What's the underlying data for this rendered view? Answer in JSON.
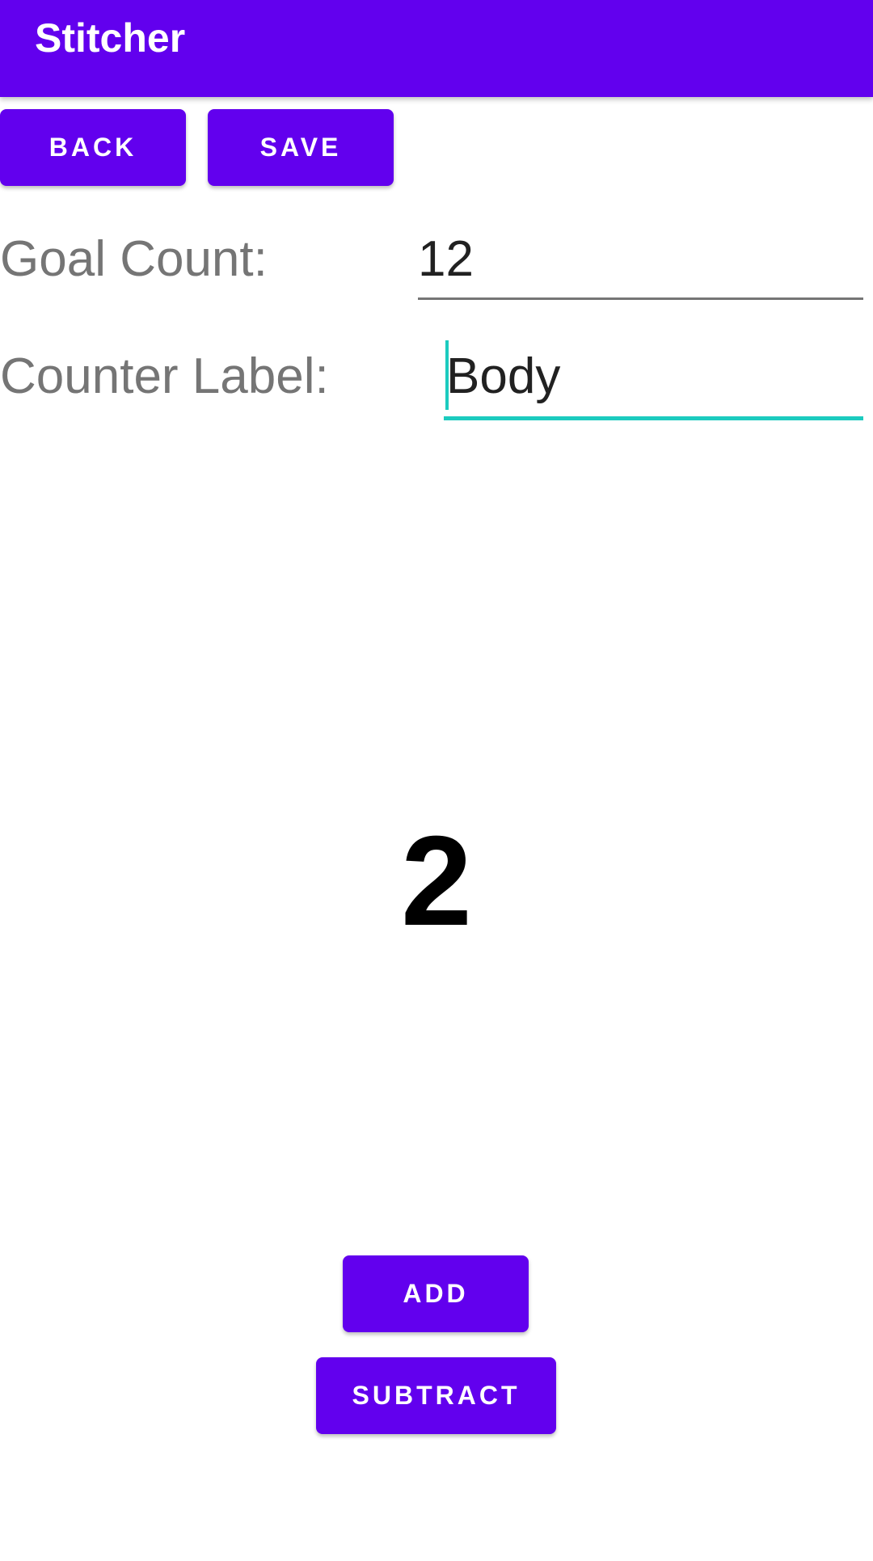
{
  "app_bar": {
    "title": "Stitcher",
    "color": "#6200EE"
  },
  "toolbar": {
    "back_label": "BACK",
    "save_label": "SAVE"
  },
  "form": {
    "goal_count_label": "Goal Count:",
    "goal_count_value": "12",
    "counter_label_label": "Counter Label:",
    "counter_label_value": "Body",
    "focus_color": "#1CCBBF"
  },
  "counter": {
    "value": "2"
  },
  "actions": {
    "add_label": "ADD",
    "subtract_label": "SUBTRACT"
  }
}
